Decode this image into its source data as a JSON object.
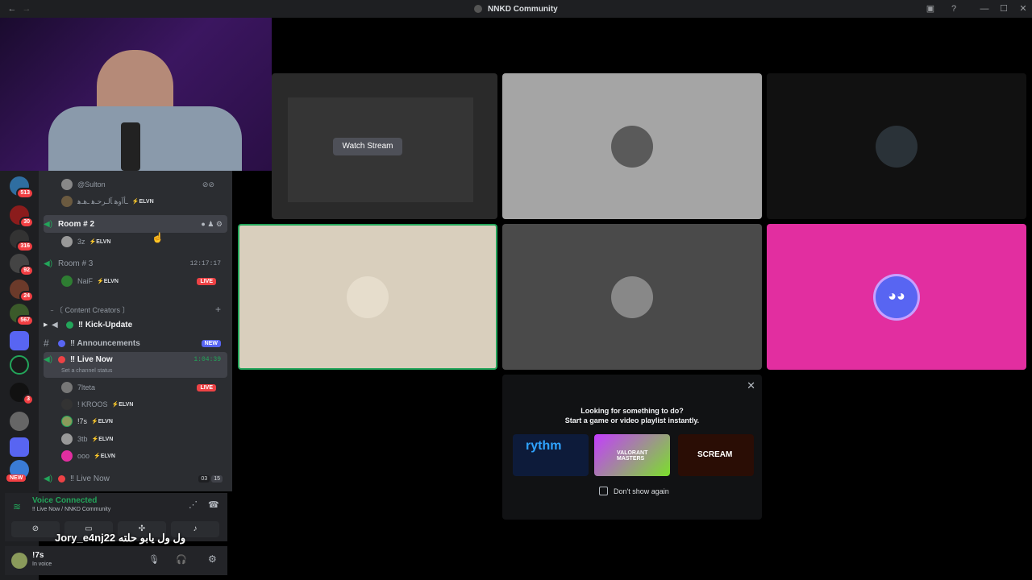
{
  "window": {
    "title": "NNKD Community"
  },
  "servers": [
    {
      "badge": "513"
    },
    {
      "badge": "30"
    },
    {
      "badge": "316"
    },
    {
      "badge": "92"
    },
    {
      "badge": "24"
    },
    {
      "badge": "567"
    },
    {
      "badge": ""
    },
    {
      "badge": "3"
    },
    {
      "badge": "NEW"
    }
  ],
  "channels": {
    "room1_users": [
      {
        "name": "@Sulton",
        "tag": ""
      },
      {
        "name": "ـأﺁوﮬ ﺂلـرحـﮬ ـﮬـﮬ",
        "tag": "⚡ELVN"
      }
    ],
    "room2": {
      "name": "Room # 2",
      "users": [
        {
          "name": "3z",
          "tag": "⚡ELVN"
        }
      ]
    },
    "room3": {
      "name": "Room # 3",
      "timer": "12:17:17",
      "users": [
        {
          "name": "NaiF",
          "tag": "⚡ELVN",
          "live": "LIVE"
        }
      ]
    },
    "category": "﹣〔 Content Creators 〕",
    "kick_update": "‼ Kick-Update",
    "announcements": "‼ Announcements",
    "announcements_badge": "NEW",
    "live_now": {
      "name": "‼ Live Now",
      "timer": "1:04:39",
      "status": "Set a channel status"
    },
    "live_users": [
      {
        "name": "7lteta",
        "tag": "",
        "live": "LIVE"
      },
      {
        "name": "! KROOS",
        "tag": "⚡ELVN"
      },
      {
        "name": "!7s",
        "tag": "⚡ELVN"
      },
      {
        "name": "3tb",
        "tag": "⚡ELVN"
      },
      {
        "name": "ooo",
        "tag": "⚡ELVN"
      }
    ],
    "live_now2": {
      "name": "‼ Live Now",
      "count": "03",
      "limit": "15"
    }
  },
  "voice": {
    "status": "Voice Connected",
    "location": "‼ Live Now / NNKD Community"
  },
  "user": {
    "name": "!7s",
    "status": "In voice"
  },
  "stream": {
    "watch_label": "Watch Stream"
  },
  "overlay": {
    "caption": "Jory_e4nj22  ول ول يابو حلته"
  },
  "activity": {
    "line1": "Looking for something to do?",
    "line2": "Start a game or video playlist instantly.",
    "dont_show": "Don't show again",
    "cards": [
      {
        "name": "rythm"
      },
      {
        "name": "VALORANT MASTERS"
      },
      {
        "name": "SCREAM"
      }
    ]
  },
  "colors": {
    "accent": "#23a55a",
    "pink": "#e22ea0",
    "live": "#ed4245",
    "blurple": "#5865f2"
  }
}
